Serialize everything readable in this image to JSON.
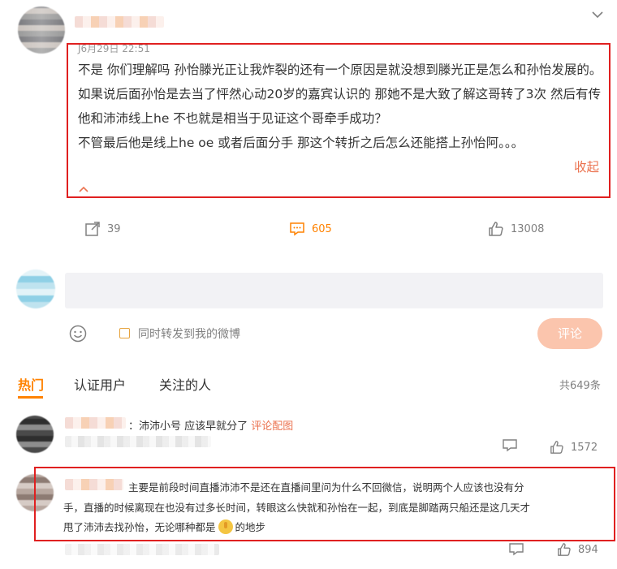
{
  "post": {
    "timestamp": "J6月29日 22:51",
    "paragraphs": [
      "不是 你们理解吗 孙怡滕光正让我炸裂的还有一个原因是就没想到滕光正是怎么和孙怡发展的。",
      "如果说后面孙怡是去当了怦然心动20岁的嘉宾认识的 那她不是大致了解这哥转了3次 然后有传他和沛沛线上he 不也就是相当于见证这个哥牵手成功？",
      "不管最后他是线上he oe 或者后面分手 那这个转折之后怎么还能搭上孙怡阿。。。"
    ],
    "collapse_label": "收起",
    "actions": {
      "repost_count": "39",
      "comment_count": "605",
      "like_count": "13008"
    }
  },
  "reply_box": {
    "placeholder": "",
    "repost_checkbox_label": "同时转发到我的微博",
    "submit_label": "评论"
  },
  "tabs": {
    "items": [
      "热门",
      "认证用户",
      "关注的人"
    ],
    "active": "热门",
    "total": "共649条"
  },
  "comments": [
    {
      "text_prefix": "：沛沛小号 应该早就分了 ",
      "link": "评论配图",
      "like_count": "1572"
    },
    {
      "line1": "主要是前段时间直播沛沛不是还在直播间里问为什么不回微信，说明两个人应该也没有分",
      "line2": "手，直播的时候离现在也没有过多长时间，转眼这么快就和孙怡在一起，到底是脚踏两只船还是这几天才",
      "line3_before": "甩了沛沛去找孙怡，无论哪种都是",
      "line3_after": "的地步",
      "like_count": "894"
    }
  ],
  "colors": {
    "accent": "#ff8200",
    "link": "#eb7350",
    "highlight_box": "#e02020"
  },
  "icons": [
    "chevron-down-icon",
    "repost-icon",
    "comment-icon",
    "like-icon",
    "emoji-icon",
    "thumbs-up-emoji-icon"
  ]
}
